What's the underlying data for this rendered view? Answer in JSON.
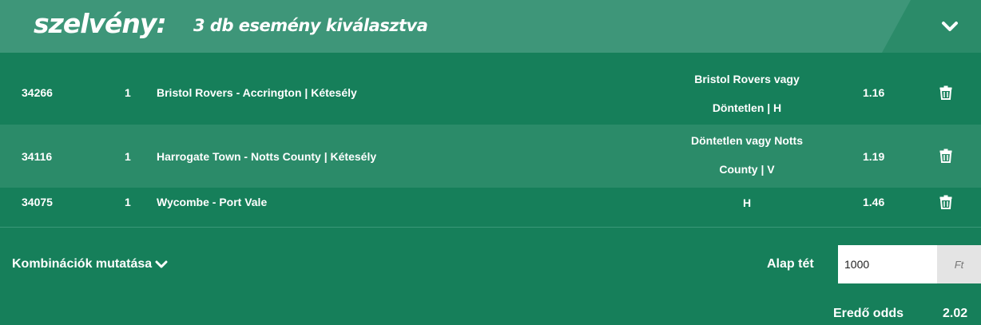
{
  "header": {
    "brand": "szelvény:",
    "subtitle": "3 db esemény kiválasztva",
    "collapse_icon": "chevron-down-icon"
  },
  "selections": [
    {
      "id": "34266",
      "num": "1",
      "match": "Bristol Rovers - Accrington | Kétesély",
      "pick_line1": "Bristol Rovers vagy",
      "pick_line2": "Döntetlen | H",
      "odds": "1.16"
    },
    {
      "id": "34116",
      "num": "1",
      "match": "Harrogate Town - Notts County | Kétesély",
      "pick_line1": "Döntetlen vagy Notts",
      "pick_line2": "County | V",
      "odds": "1.19"
    },
    {
      "id": "34075",
      "num": "1",
      "match": "Wycombe - Port Vale",
      "pick_line1": "H",
      "pick_line2": "",
      "odds": "1.46"
    }
  ],
  "combinations": {
    "label": "Kombinációk mutatása"
  },
  "stake": {
    "label": "Alap tét",
    "value": "1000",
    "unit": "Ft"
  },
  "total": {
    "label": "Eredő odds",
    "value": "2.02"
  },
  "colors": {
    "background": "#167f5a",
    "row_alt": "#2b8b69",
    "header_band": "#3e9679"
  }
}
